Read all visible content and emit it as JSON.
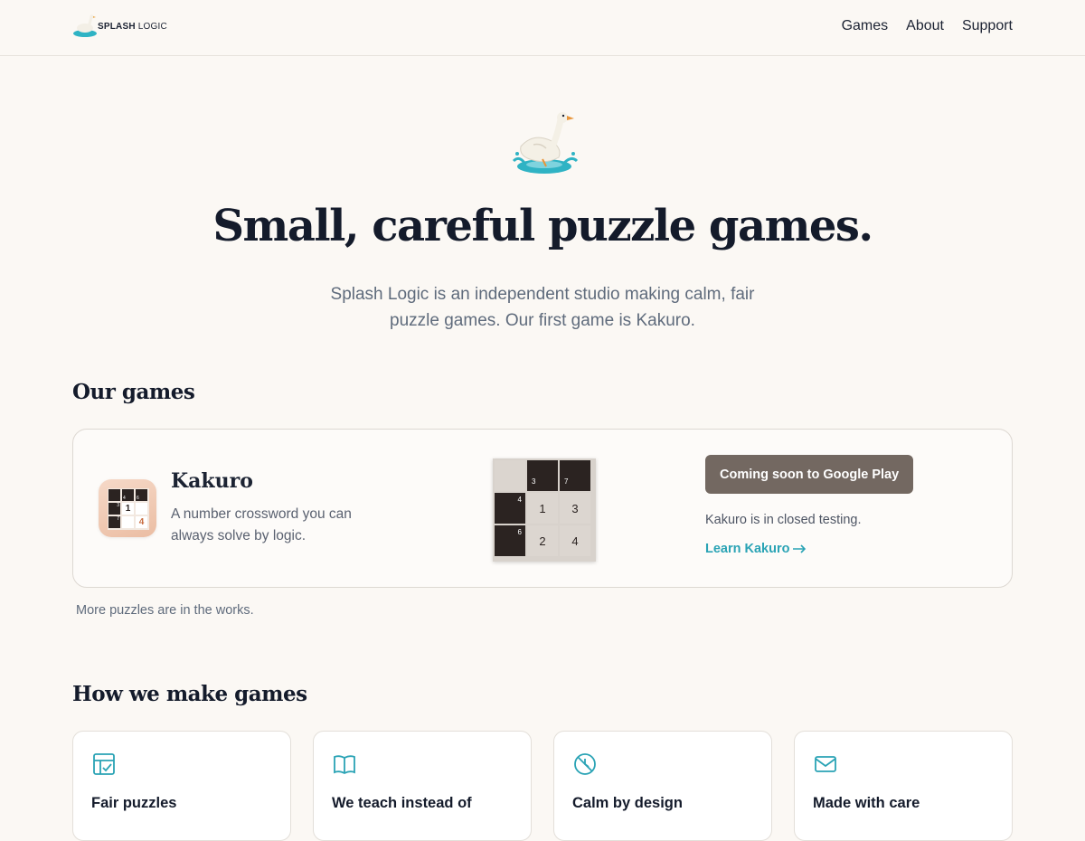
{
  "header": {
    "logo_text_bold": "SPLASH",
    "logo_text_light": "LOGIC",
    "nav": [
      {
        "label": "Games"
      },
      {
        "label": "About"
      },
      {
        "label": "Support"
      }
    ]
  },
  "hero": {
    "title": "Small, careful puzzle games.",
    "subtitle": "Splash Logic is an independent studio making calm, fair puzzle games. Our first game is Kakuro."
  },
  "games_section": {
    "title": "Our games",
    "game": {
      "name": "Kakuro",
      "description": "A number crossword you can always solve by logic.",
      "app_icon_grid": {
        "clues": [
          "4",
          "6",
          "3",
          "7"
        ],
        "values": [
          "1",
          "4"
        ]
      },
      "preview": {
        "clue_top": [
          "3",
          "7"
        ],
        "clue_left": [
          "4",
          "6"
        ],
        "values": [
          "1",
          "3",
          "2",
          "4"
        ]
      },
      "button_label": "Coming soon to Google Play",
      "status": "Kakuro is in closed testing.",
      "link_label": "Learn Kakuro"
    },
    "more_note": "More puzzles are in the works."
  },
  "how_section": {
    "title": "How we make games",
    "cards": [
      {
        "title": "Fair puzzles",
        "icon": "checklist-icon"
      },
      {
        "title": "We teach instead of",
        "icon": "book-icon"
      },
      {
        "title": "Calm by design",
        "icon": "no-ads-icon"
      },
      {
        "title": "Made with care",
        "icon": "mail-icon"
      }
    ]
  },
  "colors": {
    "background": "#fbf8f4",
    "accent": "#2aa3b5",
    "button": "#736861",
    "dark_cell": "#2b2321"
  }
}
